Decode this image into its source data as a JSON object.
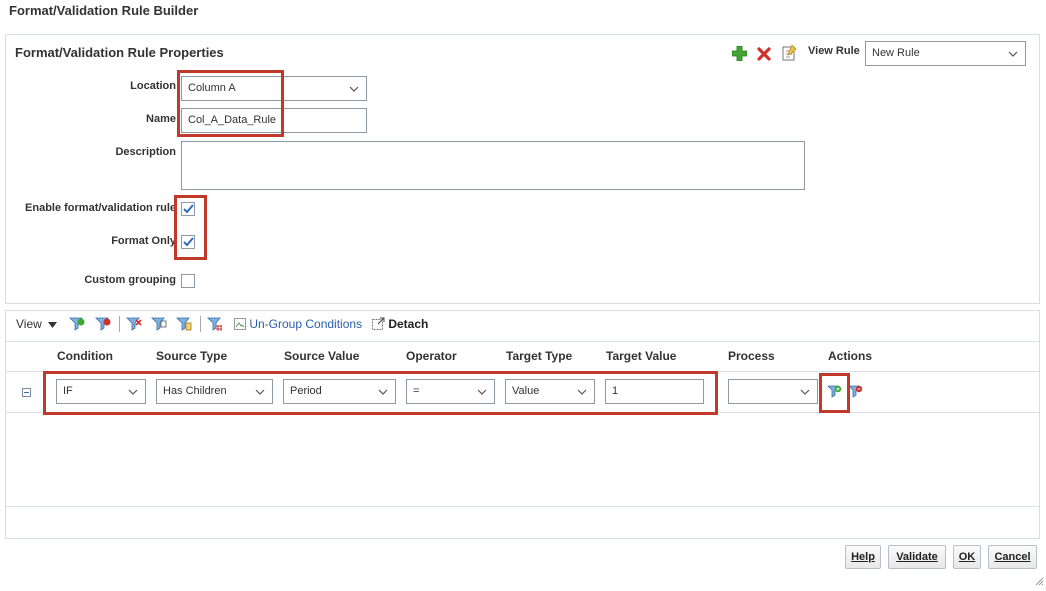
{
  "dialog": {
    "title": "Format/Validation Rule Builder"
  },
  "properties": {
    "title": "Format/Validation Rule Properties",
    "view_rule_label": "View Rule",
    "view_rule_value": "New Rule",
    "location_label": "Location",
    "location_value": "Column A",
    "name_label": "Name",
    "name_value": "Col_A_Data_Rule",
    "description_label": "Description",
    "description_value": "",
    "enable_label": "Enable format/validation rule",
    "enable_checked": true,
    "format_only_label": "Format Only",
    "format_only_checked": true,
    "custom_grouping_label": "Custom grouping",
    "custom_grouping_checked": false
  },
  "conditions": {
    "view_label": "View",
    "ungroup_label": "Un-Group Conditions",
    "detach_label": "Detach",
    "columns": [
      "Condition",
      "Source Type",
      "Source Value",
      "Operator",
      "Target Type",
      "Target Value",
      "Process",
      "Actions"
    ],
    "rows": [
      {
        "condition": "IF",
        "source_type": "Has Children",
        "source_value": "Period",
        "operator": "=",
        "target_type": "Value",
        "target_value": "1",
        "process": ""
      }
    ]
  },
  "buttons": {
    "help": "Help",
    "validate": "Validate",
    "ok": "OK",
    "cancel": "Cancel"
  },
  "colors": {
    "accent_red": "#c0392b",
    "add_green": "#3fa535",
    "delete_red": "#d0302a",
    "border": "#d6dde5"
  }
}
